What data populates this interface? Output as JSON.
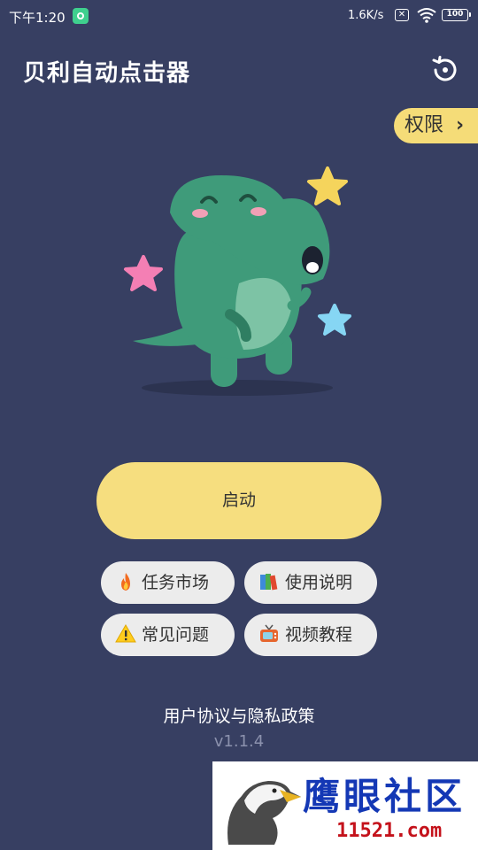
{
  "status_bar": {
    "time": "下午1:20",
    "net_speed": "1.6K/s",
    "sim_glyph": "✕",
    "battery": "100"
  },
  "header": {
    "title": "贝利自动点击器",
    "history_icon": "history-restore-icon"
  },
  "permission_tab": {
    "label": "权限",
    "chevron": "›"
  },
  "main": {
    "start_label": "启动",
    "buttons": [
      {
        "emoji": "fire-icon",
        "label": "任务市场"
      },
      {
        "emoji": "books-icon",
        "label": "使用说明"
      },
      {
        "emoji": "warning-icon",
        "label": "常见问题"
      },
      {
        "emoji": "tv-icon",
        "label": "视频教程"
      }
    ],
    "policy_link": "用户协议与隐私政策",
    "version": "v1.1.4"
  },
  "watermark": {
    "title": "鹰眼社区",
    "url": "11521.com"
  },
  "colors": {
    "background": "#373f62",
    "accent_yellow": "#f6de7f",
    "pill_bg": "#ececec",
    "dino_green": "#3f9b7a"
  }
}
